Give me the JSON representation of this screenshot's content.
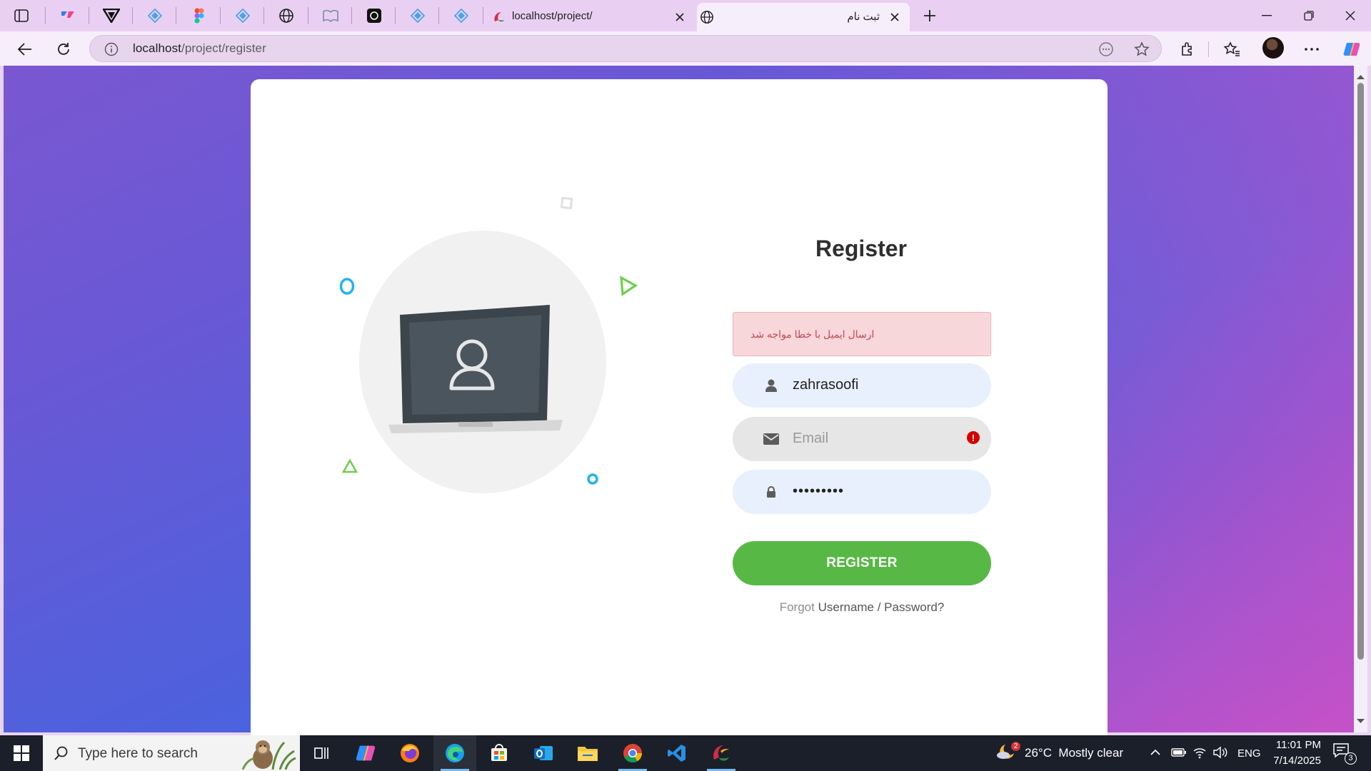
{
  "browser": {
    "tabs": [
      {
        "title": "localhost/project/",
        "active": false
      },
      {
        "title": "ثبت نام",
        "active": true
      }
    ],
    "url_host": "localhost",
    "url_path": "/project/register"
  },
  "page": {
    "title": "Register",
    "alert": "ارسال ایمیل با خطا مواجه شد",
    "username_value": "zahrasoofi",
    "email_placeholder": "Email",
    "password_value": "•••••••••",
    "register_button": "REGISTER",
    "forgot_prefix": "Forgot",
    "forgot_link": "Username / Password?",
    "email_error_icon": "!"
  },
  "taskbar": {
    "search_placeholder": "Type here to search",
    "weather": "26°C  Mostly clear",
    "weather_badge": "2",
    "language": "ENG",
    "time": "11:01 PM",
    "date": "7/14/2025",
    "notifications": "3"
  },
  "colors": {
    "accent_green": "#57b846",
    "alert_bg": "#f8d7da",
    "alert_text": "#c14953"
  }
}
